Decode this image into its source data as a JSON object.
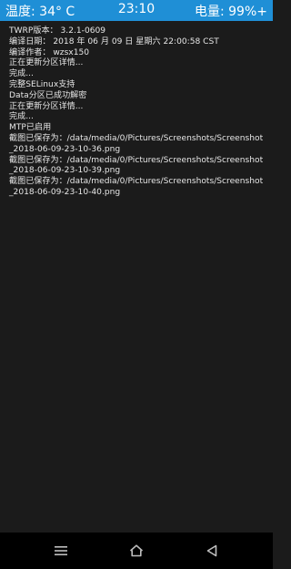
{
  "status_bar": {
    "temperature": "温度: 34° C",
    "time": "23:10",
    "battery": "电量: 99%+"
  },
  "console": {
    "lines": [
      "TWRP版本： 3.2.1-0609",
      "编译日期： 2018 年 06 月 09 日 星期六 22:00:58 CST",
      "编译作者： wzsx150",
      "正在更新分区详情...",
      "完成...",
      "完整SELinux支持",
      "Data分区已成功解密",
      "正在更新分区详情...",
      "完成...",
      "MTP已启用",
      "截图已保存为：/data/media/0/Pictures/Screenshots/Screenshot",
      "_2018-06-09-23-10-36.png",
      "截图已保存为：/data/media/0/Pictures/Screenshots/Screenshot",
      "_2018-06-09-23-10-39.png",
      "截图已保存为：/data/media/0/Pictures/Screenshots/Screenshot",
      "_2018-06-09-23-10-40.png"
    ]
  },
  "nav_bar": {
    "menu_icon": "menu-icon",
    "home_icon": "home-icon",
    "back_icon": "back-icon"
  },
  "colors": {
    "status_bar_bg": "#1f8fd6",
    "console_bg": "#1b1b1b",
    "console_text": "#e6e6e6",
    "nav_bg": "#000000"
  }
}
